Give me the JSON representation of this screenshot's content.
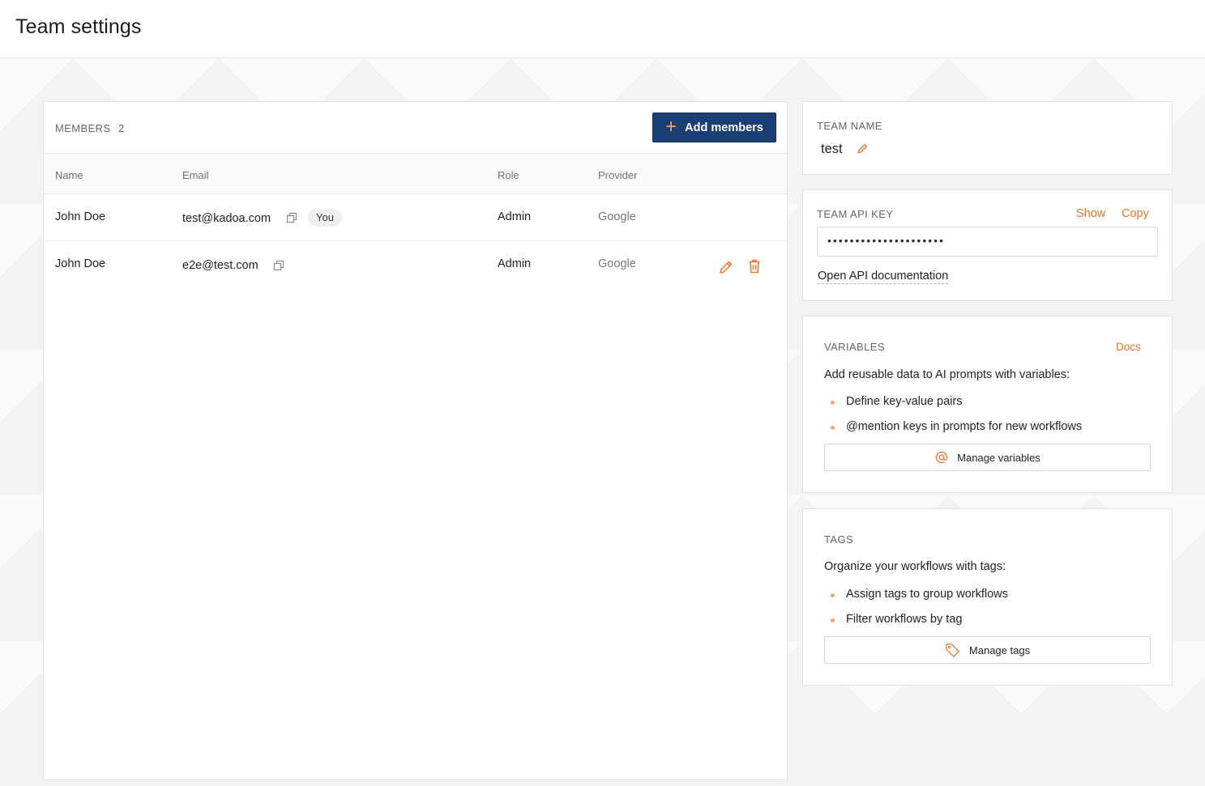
{
  "header": {
    "title": "Team settings"
  },
  "members": {
    "label": "MEMBERS",
    "count": "2",
    "add_button": "Add members",
    "columns": [
      "Name",
      "Email",
      "Role",
      "Provider"
    ],
    "rows": [
      {
        "name": "John Doe",
        "email": "test@kadoa.com",
        "badge": "You",
        "role": "Admin",
        "provider": "Google"
      },
      {
        "name": "John Doe",
        "email": "e2e@test.com",
        "role": "Admin",
        "provider": "Google"
      }
    ]
  },
  "team_name": {
    "label": "TEAM NAME",
    "value": "test"
  },
  "api_key": {
    "label": "TEAM API KEY",
    "show": "Show",
    "copy": "Copy",
    "masked_value": "•••••••••••••••••••••",
    "doc_link": "Open API documentation"
  },
  "variables": {
    "label": "VARIABLES",
    "docs": "Docs",
    "description": "Add reusable data to AI prompts with variables:",
    "bullets": [
      "Define key-value pairs",
      "@mention keys in prompts for new workflows"
    ],
    "button": "Manage variables"
  },
  "tags": {
    "label": "TAGS",
    "description": "Organize your workflows with tags:",
    "bullets": [
      "Assign tags to group workflows",
      "Filter workflows by tag"
    ],
    "button": "Manage tags"
  },
  "colors": {
    "accent": "#e8762c",
    "primary": "#1b3f73"
  }
}
